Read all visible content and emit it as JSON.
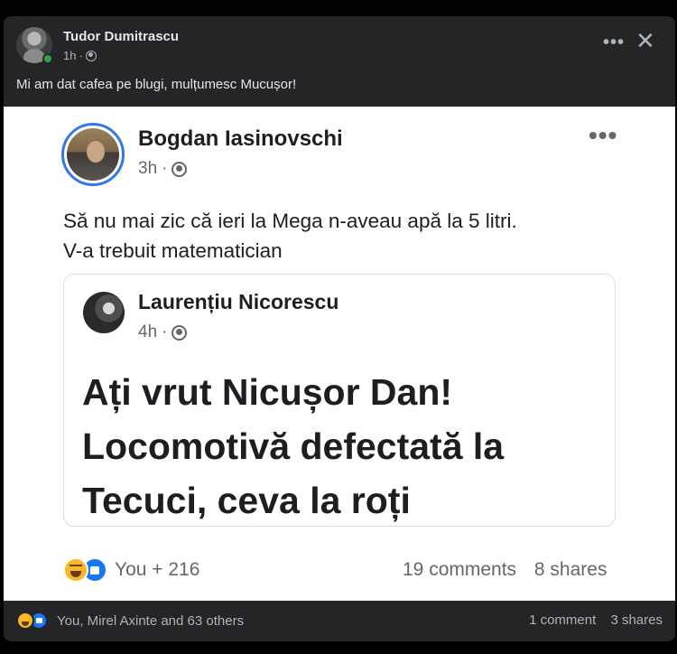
{
  "outer_post": {
    "author": "Tudor Dumitrascu",
    "time": "1h",
    "time_separator": "·",
    "text": "Mi am dat cafea pe blugi, mulțumesc Mucușor!",
    "more_label": "•••",
    "close_label": "✕"
  },
  "shared_post": {
    "author": "Bogdan Iasinovschi",
    "time": "3h",
    "time_separator": "·",
    "more_label": "•••",
    "text_line1": "Să nu mai zic că ieri la Mega n-aveau apă la 5 litri.",
    "text_line2": "V-a trebuit matematician",
    "quoted": {
      "author": "Laurențiu Nicorescu",
      "time": "4h",
      "time_separator": "·",
      "text_line1": "Ați vrut Nicușor Dan!",
      "text_line2": "Locomotivă defectată la",
      "text_line3": "Tecuci, ceva la roți"
    },
    "reactions_label": "You + 216",
    "comments": "19 comments",
    "shares": "8 shares"
  },
  "footer": {
    "reactions_label": "You, Mirel Axinte and 63 others",
    "comments": "1 comment",
    "shares": "3 shares"
  },
  "colors": {
    "background": "#000000",
    "card": "#242526",
    "accent": "#1877f2",
    "haha": "#f7b928",
    "online": "#31a24c"
  }
}
